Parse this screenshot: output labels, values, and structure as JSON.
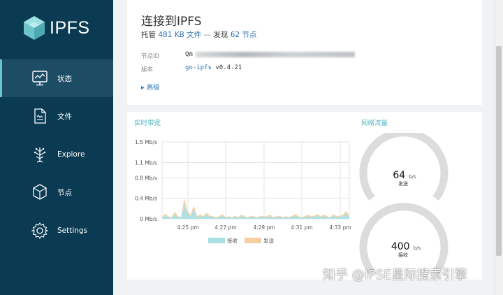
{
  "app": {
    "logo_text": "IPFS",
    "brand_color": "#0b3a53",
    "accent_color": "#69c4cd"
  },
  "sidebar": {
    "items": [
      {
        "label": "状态",
        "icon": "status-monitor-icon",
        "active": true
      },
      {
        "label": "文件",
        "icon": "files-icon",
        "active": false
      },
      {
        "label": "Explore",
        "icon": "explore-tree-icon",
        "active": false
      },
      {
        "label": "节点",
        "icon": "peers-cube-icon",
        "active": false
      },
      {
        "label": "Settings",
        "icon": "settings-gear-icon",
        "active": false
      }
    ]
  },
  "status": {
    "title": "连接到IPFS",
    "hosting_prefix": "托管",
    "hosting_size": "481 KB 文件",
    "separator": "—",
    "discover_prefix": "发现",
    "peers_count": "62 节点",
    "node_id_label": "节点ID",
    "node_id_value": "Qm",
    "version_label": "版本",
    "version_name": "go-ipfs",
    "version_number": "v0.4.21",
    "advanced_label": "▸ 高级"
  },
  "bandwidth": {
    "title": "实时带宽",
    "legend": [
      {
        "label": "接收",
        "color": "#a9dfe3"
      },
      {
        "label": "发送",
        "color": "#f5cfa0"
      }
    ]
  },
  "traffic": {
    "title": "网络流量",
    "gauges": [
      {
        "value": "64",
        "unit": "b/s",
        "label": "发送"
      },
      {
        "value": "400",
        "unit": "b/s",
        "label": "接收"
      }
    ]
  },
  "chart_data": {
    "type": "area",
    "title": "实时带宽",
    "y_tick_labels": [
      "0 Mb/s",
      "0.4 Mb/s",
      "0.8 Mb/s",
      "1.1 Mb/s",
      "1.5 Mb/s"
    ],
    "y_ticks": [
      0,
      0.4,
      0.8,
      1.1,
      1.5
    ],
    "ylim": [
      0,
      1.5
    ],
    "x_tick_labels": [
      "4:25 pm",
      "4:27 pm",
      "4:29 pm",
      "4:31 pm",
      "4:33 pm"
    ],
    "series": [
      {
        "name": "接收",
        "color": "#a9dfe3",
        "values": [
          0.02,
          0.06,
          0.03,
          0.02,
          0.08,
          0.03,
          0.02,
          0.28,
          0.1,
          0.05,
          0.18,
          0.03,
          0.05,
          0.03,
          0.08,
          0.04,
          0.03,
          0.02,
          0.03,
          0.06,
          0.02,
          0.03,
          0.02,
          0.04,
          0.02,
          0.05,
          0.03,
          0.02,
          0.04,
          0.03,
          0.02,
          0.04,
          0.03,
          0.03,
          0.05,
          0.02,
          0.03,
          0.04,
          0.02,
          0.03,
          0.02,
          0.04,
          0.06,
          0.03,
          0.02,
          0.03,
          0.05,
          0.03,
          0.04,
          0.06,
          0.03,
          0.05,
          0.03,
          0.02,
          0.06,
          0.03,
          0.04,
          0.05,
          0.1,
          0.04
        ]
      },
      {
        "name": "发送",
        "color": "#f5cfa0",
        "values": [
          0.01,
          0.04,
          0.02,
          0.01,
          0.06,
          0.02,
          0.02,
          0.12,
          0.06,
          0.03,
          0.08,
          0.02,
          0.03,
          0.02,
          0.04,
          0.02,
          0.02,
          0.01,
          0.02,
          0.03,
          0.01,
          0.02,
          0.01,
          0.02,
          0.01,
          0.03,
          0.02,
          0.01,
          0.02,
          0.02,
          0.01,
          0.02,
          0.02,
          0.02,
          0.03,
          0.01,
          0.02,
          0.02,
          0.01,
          0.02,
          0.01,
          0.02,
          0.03,
          0.02,
          0.01,
          0.02,
          0.03,
          0.02,
          0.02,
          0.03,
          0.02,
          0.03,
          0.02,
          0.01,
          0.03,
          0.02,
          0.02,
          0.03,
          0.05,
          0.02
        ]
      }
    ],
    "grid": true,
    "legend_position": "bottom"
  },
  "watermark": {
    "text": "知乎 @IPSE星际搜索引擎"
  }
}
